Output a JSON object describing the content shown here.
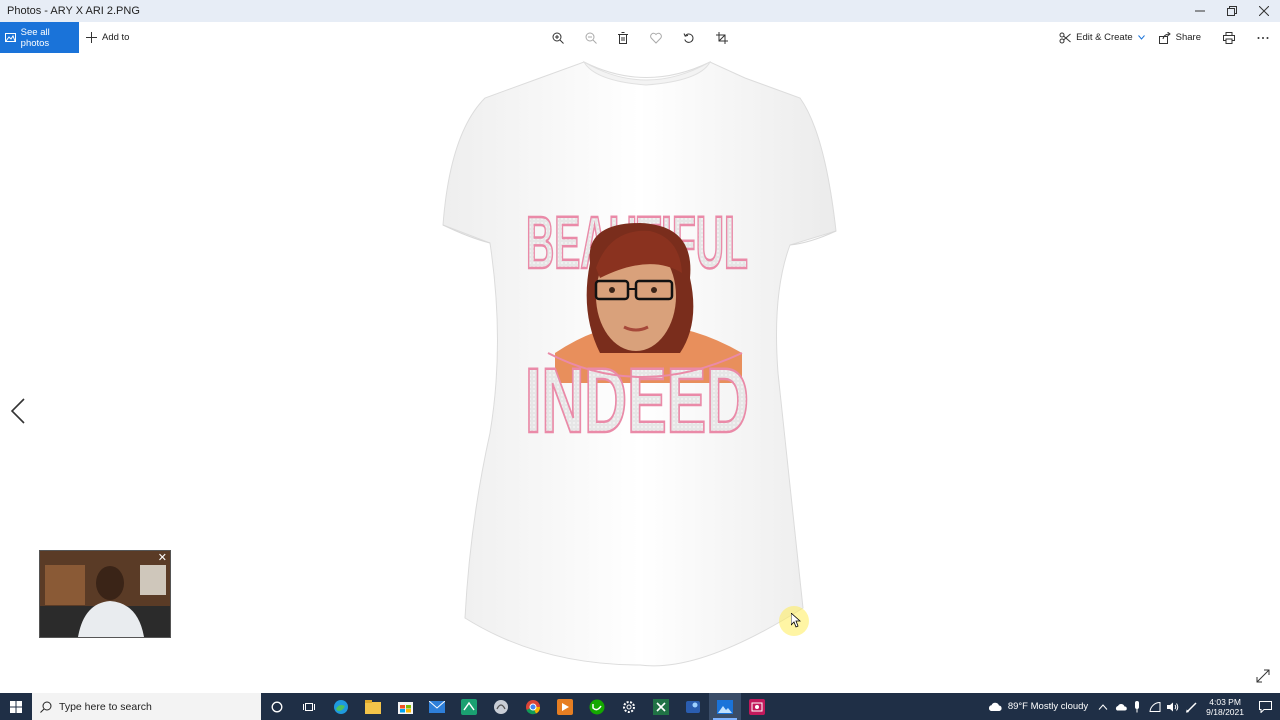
{
  "window": {
    "title": "Photos - ARY X ARI 2.PNG"
  },
  "toolbar": {
    "see_all_photos": "See all photos",
    "add_to": "Add to",
    "edit_create": "Edit & Create",
    "share": "Share"
  },
  "artwork": {
    "top_word": "BEAUTIFUL",
    "bottom_word": "INDEED"
  },
  "taskbar": {
    "search_placeholder": "Type here to search",
    "weather": "89°F  Mostly cloudy",
    "time": "4:03 PM",
    "date": "9/18/2021"
  },
  "colors": {
    "accent": "#1a73d9",
    "title_bar": "#e7edf6",
    "taskbar": "#1f2f46",
    "text_pink": "#e98aa8"
  }
}
